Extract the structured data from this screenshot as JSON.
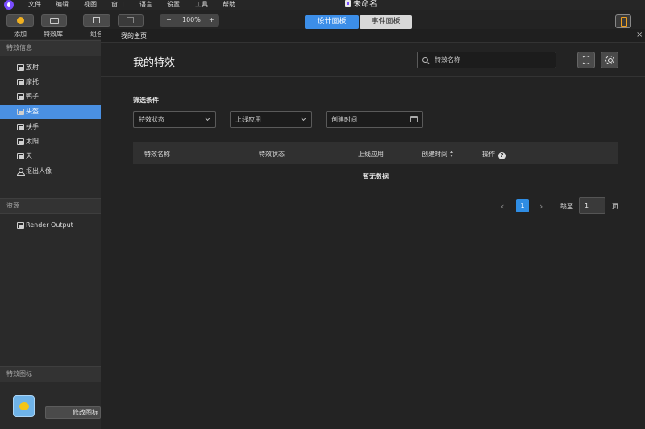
{
  "menubar": {
    "items": [
      "文件",
      "编辑",
      "视图",
      "窗口",
      "语言",
      "设置",
      "工具",
      "帮助"
    ],
    "window_title": "未命名"
  },
  "toolbar": {
    "add_label": "添加",
    "library_label": "特效库",
    "group_label": "组合",
    "zoom_minus": "−",
    "zoom_value": "100%",
    "zoom_plus": "+",
    "design_tab": "设计面板",
    "event_tab": "事件面板"
  },
  "sidebar": {
    "effects_header": "特效信息",
    "items": [
      {
        "label": "放射",
        "icon": "layer-icon",
        "selected": false
      },
      {
        "label": "摩托",
        "icon": "layer-icon",
        "selected": false
      },
      {
        "label": "鸭子",
        "icon": "layer-icon",
        "selected": false
      },
      {
        "label": "头盔",
        "icon": "layer-icon",
        "selected": true
      },
      {
        "label": "扶手",
        "icon": "layer-icon",
        "selected": false
      },
      {
        "label": "太阳",
        "icon": "layer-icon",
        "selected": false
      },
      {
        "label": "天",
        "icon": "layer-icon",
        "selected": false
      },
      {
        "label": "抠出人像",
        "icon": "person-icon",
        "selected": false
      }
    ],
    "resources_header": "资源",
    "resource_items": [
      {
        "label": "Render Output"
      }
    ],
    "effect_icon_header": "特效图标",
    "edit_icon_button": "修改图标"
  },
  "main": {
    "tab_title": "我的主页",
    "close_symbol": "×",
    "page_title": "我的特效",
    "search_placeholder": "特效名称",
    "filter_label": "筛选条件",
    "filters": {
      "status": "特效状态",
      "app": "上线应用",
      "created": "创建时间"
    },
    "table": {
      "columns": [
        "特效名称",
        "特效状态",
        "上线应用",
        "创建时间",
        "操作"
      ],
      "empty_text": "暂无数据"
    },
    "pagination": {
      "prev": "‹",
      "current_page": "1",
      "next": "›",
      "goto_label": "跳至",
      "goto_value": "1",
      "page_unit": "页"
    }
  },
  "colors": {
    "accent": "#3c8ee8",
    "selected_row": "#4a90e2",
    "background": "#232323"
  }
}
